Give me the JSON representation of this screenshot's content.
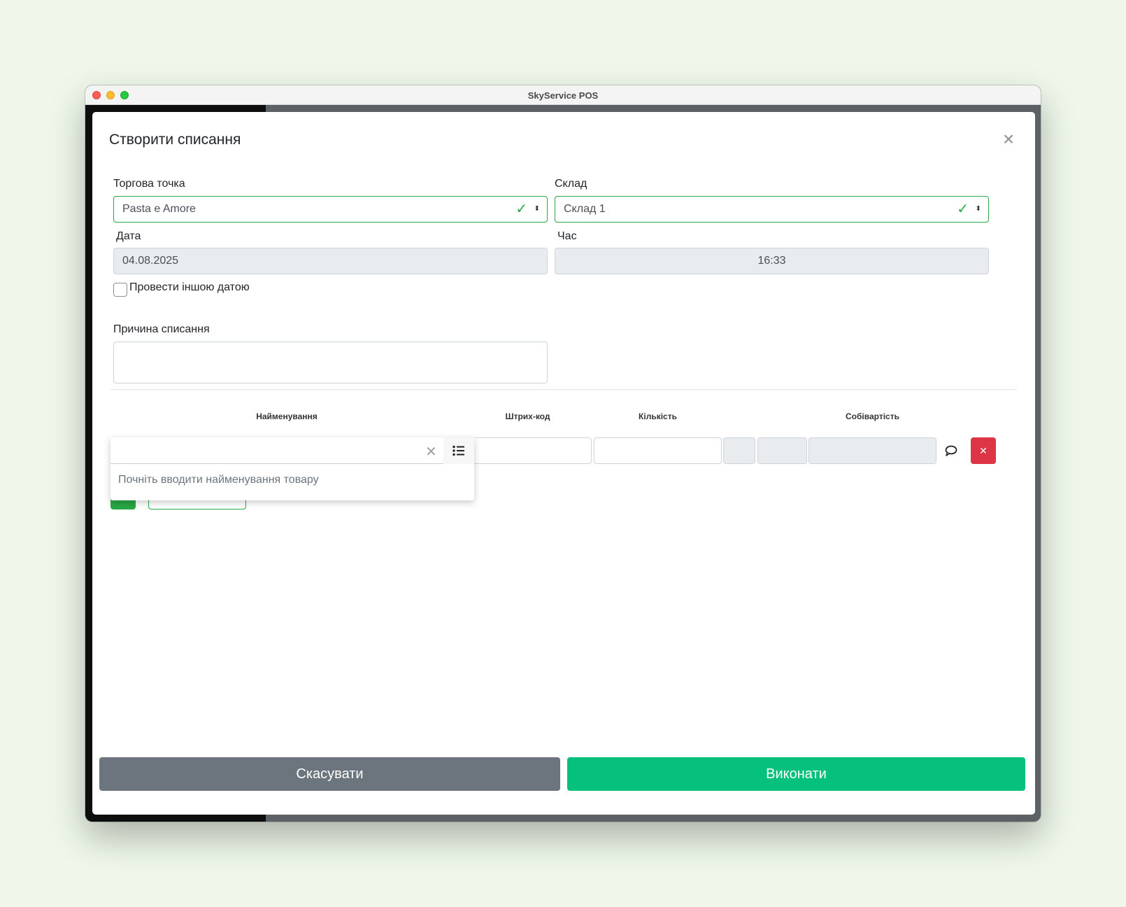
{
  "window": {
    "title": "SkyService POS"
  },
  "modal": {
    "title": "Створити списання",
    "close_icon": "close-icon"
  },
  "form": {
    "store_label": "Торгова точка",
    "store_value": "Pasta e Amore",
    "warehouse_label": "Склад",
    "warehouse_value": "Склад 1",
    "date_label": "Дата",
    "date_value": "04.08.2025",
    "time_label": "Час",
    "time_value": "16:33",
    "other_date_label": "Провести іншою датою",
    "other_date_checked": false,
    "reason_label": "Причина списання",
    "reason_value": ""
  },
  "table": {
    "headers": {
      "name": "Найменування",
      "barcode": "Штрих-код",
      "quantity": "Кількість",
      "cost": "Собівартість"
    },
    "row": {
      "name_value": "",
      "barcode_value": "",
      "quantity_value": "",
      "cost_value": ""
    },
    "search_hint": "Почніть вводити найменування товару"
  },
  "footer": {
    "cancel_label": "Скасувати",
    "submit_label": "Виконати"
  },
  "colors": {
    "accent_green": "#05c17c",
    "valid_green": "#28a745",
    "danger_red": "#dc3545",
    "secondary_gray": "#6c757d"
  }
}
